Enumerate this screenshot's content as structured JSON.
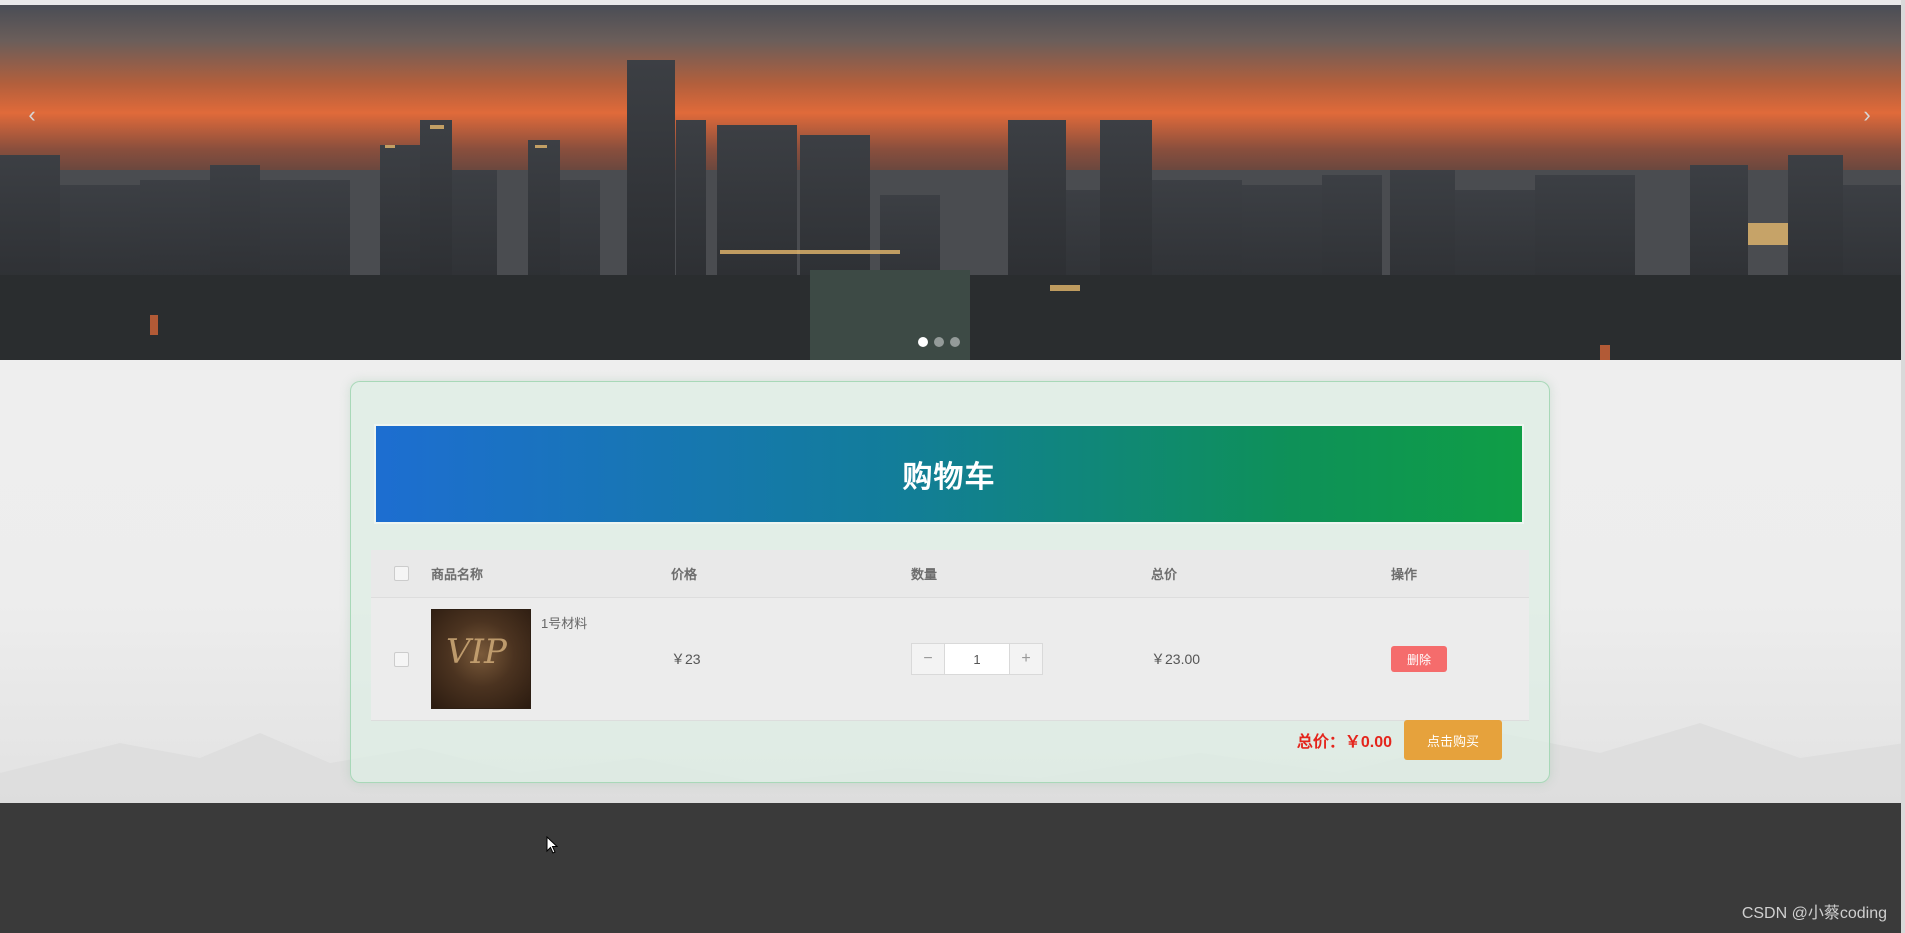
{
  "banner": {
    "prev_arrow": "‹",
    "next_arrow": "›",
    "slides": 3,
    "active_slide": 0
  },
  "cart": {
    "title": "购物车",
    "columns": [
      "商品名称",
      "价格",
      "数量",
      "总价",
      "操作"
    ],
    "items": [
      {
        "name": "1号材料",
        "price": "￥23",
        "quantity": "1",
        "total": "￥23.00",
        "image_text": "VIP",
        "delete_label": "删除"
      }
    ],
    "summary_label": "总价：￥0.00",
    "buy_label": "点击购买",
    "colors": {
      "title_gradient_start": "#1d6ed1",
      "title_gradient_end": "#0f9e46",
      "delete": "#f56c6c",
      "buy": "#e6a23c",
      "total_red": "#e4251c"
    }
  },
  "footer": {
    "watermark": "CSDN @小蔡coding"
  }
}
